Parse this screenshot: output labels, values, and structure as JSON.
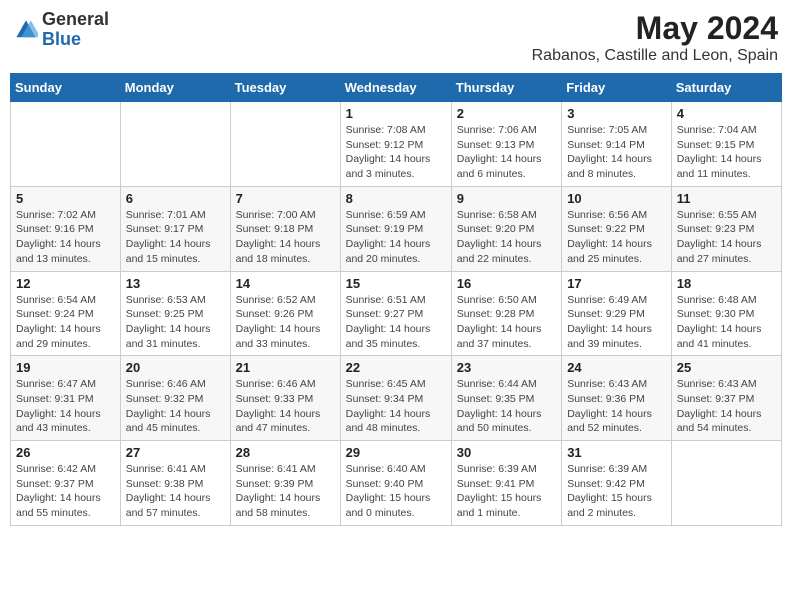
{
  "header": {
    "logo_general": "General",
    "logo_blue": "Blue",
    "title": "May 2024",
    "location": "Rabanos, Castille and Leon, Spain"
  },
  "days_of_week": [
    "Sunday",
    "Monday",
    "Tuesday",
    "Wednesday",
    "Thursday",
    "Friday",
    "Saturday"
  ],
  "weeks": [
    [
      {
        "day": "",
        "info": ""
      },
      {
        "day": "",
        "info": ""
      },
      {
        "day": "",
        "info": ""
      },
      {
        "day": "1",
        "info": "Sunrise: 7:08 AM\nSunset: 9:12 PM\nDaylight: 14 hours\nand 3 minutes."
      },
      {
        "day": "2",
        "info": "Sunrise: 7:06 AM\nSunset: 9:13 PM\nDaylight: 14 hours\nand 6 minutes."
      },
      {
        "day": "3",
        "info": "Sunrise: 7:05 AM\nSunset: 9:14 PM\nDaylight: 14 hours\nand 8 minutes."
      },
      {
        "day": "4",
        "info": "Sunrise: 7:04 AM\nSunset: 9:15 PM\nDaylight: 14 hours\nand 11 minutes."
      }
    ],
    [
      {
        "day": "5",
        "info": "Sunrise: 7:02 AM\nSunset: 9:16 PM\nDaylight: 14 hours\nand 13 minutes."
      },
      {
        "day": "6",
        "info": "Sunrise: 7:01 AM\nSunset: 9:17 PM\nDaylight: 14 hours\nand 15 minutes."
      },
      {
        "day": "7",
        "info": "Sunrise: 7:00 AM\nSunset: 9:18 PM\nDaylight: 14 hours\nand 18 minutes."
      },
      {
        "day": "8",
        "info": "Sunrise: 6:59 AM\nSunset: 9:19 PM\nDaylight: 14 hours\nand 20 minutes."
      },
      {
        "day": "9",
        "info": "Sunrise: 6:58 AM\nSunset: 9:20 PM\nDaylight: 14 hours\nand 22 minutes."
      },
      {
        "day": "10",
        "info": "Sunrise: 6:56 AM\nSunset: 9:22 PM\nDaylight: 14 hours\nand 25 minutes."
      },
      {
        "day": "11",
        "info": "Sunrise: 6:55 AM\nSunset: 9:23 PM\nDaylight: 14 hours\nand 27 minutes."
      }
    ],
    [
      {
        "day": "12",
        "info": "Sunrise: 6:54 AM\nSunset: 9:24 PM\nDaylight: 14 hours\nand 29 minutes."
      },
      {
        "day": "13",
        "info": "Sunrise: 6:53 AM\nSunset: 9:25 PM\nDaylight: 14 hours\nand 31 minutes."
      },
      {
        "day": "14",
        "info": "Sunrise: 6:52 AM\nSunset: 9:26 PM\nDaylight: 14 hours\nand 33 minutes."
      },
      {
        "day": "15",
        "info": "Sunrise: 6:51 AM\nSunset: 9:27 PM\nDaylight: 14 hours\nand 35 minutes."
      },
      {
        "day": "16",
        "info": "Sunrise: 6:50 AM\nSunset: 9:28 PM\nDaylight: 14 hours\nand 37 minutes."
      },
      {
        "day": "17",
        "info": "Sunrise: 6:49 AM\nSunset: 9:29 PM\nDaylight: 14 hours\nand 39 minutes."
      },
      {
        "day": "18",
        "info": "Sunrise: 6:48 AM\nSunset: 9:30 PM\nDaylight: 14 hours\nand 41 minutes."
      }
    ],
    [
      {
        "day": "19",
        "info": "Sunrise: 6:47 AM\nSunset: 9:31 PM\nDaylight: 14 hours\nand 43 minutes."
      },
      {
        "day": "20",
        "info": "Sunrise: 6:46 AM\nSunset: 9:32 PM\nDaylight: 14 hours\nand 45 minutes."
      },
      {
        "day": "21",
        "info": "Sunrise: 6:46 AM\nSunset: 9:33 PM\nDaylight: 14 hours\nand 47 minutes."
      },
      {
        "day": "22",
        "info": "Sunrise: 6:45 AM\nSunset: 9:34 PM\nDaylight: 14 hours\nand 48 minutes."
      },
      {
        "day": "23",
        "info": "Sunrise: 6:44 AM\nSunset: 9:35 PM\nDaylight: 14 hours\nand 50 minutes."
      },
      {
        "day": "24",
        "info": "Sunrise: 6:43 AM\nSunset: 9:36 PM\nDaylight: 14 hours\nand 52 minutes."
      },
      {
        "day": "25",
        "info": "Sunrise: 6:43 AM\nSunset: 9:37 PM\nDaylight: 14 hours\nand 54 minutes."
      }
    ],
    [
      {
        "day": "26",
        "info": "Sunrise: 6:42 AM\nSunset: 9:37 PM\nDaylight: 14 hours\nand 55 minutes."
      },
      {
        "day": "27",
        "info": "Sunrise: 6:41 AM\nSunset: 9:38 PM\nDaylight: 14 hours\nand 57 minutes."
      },
      {
        "day": "28",
        "info": "Sunrise: 6:41 AM\nSunset: 9:39 PM\nDaylight: 14 hours\nand 58 minutes."
      },
      {
        "day": "29",
        "info": "Sunrise: 6:40 AM\nSunset: 9:40 PM\nDaylight: 15 hours\nand 0 minutes."
      },
      {
        "day": "30",
        "info": "Sunrise: 6:39 AM\nSunset: 9:41 PM\nDaylight: 15 hours\nand 1 minute."
      },
      {
        "day": "31",
        "info": "Sunrise: 6:39 AM\nSunset: 9:42 PM\nDaylight: 15 hours\nand 2 minutes."
      },
      {
        "day": "",
        "info": ""
      }
    ]
  ]
}
